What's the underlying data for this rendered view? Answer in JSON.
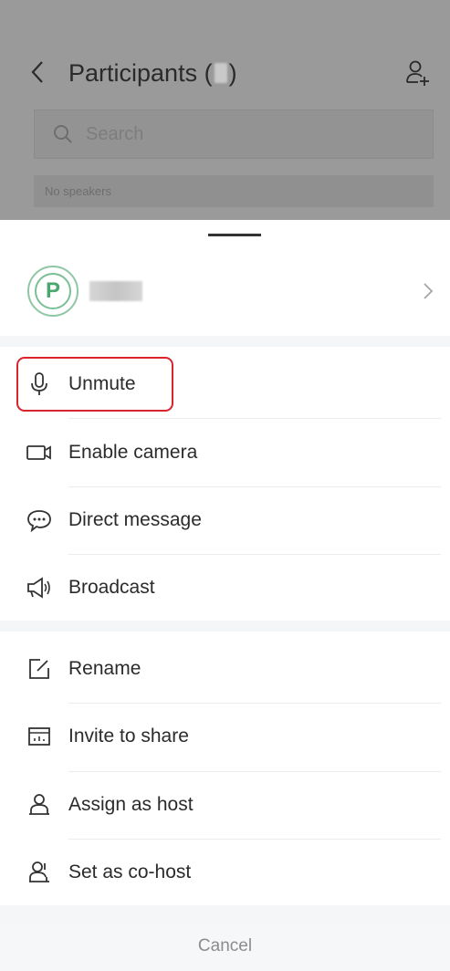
{
  "header": {
    "title": "Participants (",
    "title_suffix": ")",
    "search_placeholder": "Search",
    "speakers_text": "No speakers"
  },
  "menu": {
    "unmute": "Unmute",
    "enable_camera": "Enable camera",
    "direct_message": "Direct message",
    "broadcast": "Broadcast",
    "rename": "Rename",
    "invite_to_share": "Invite to share",
    "assign_as_host": "Assign as host",
    "set_as_cohost": "Set as co-host"
  },
  "footer": {
    "cancel": "Cancel"
  },
  "avatar_letter": "P",
  "colors": {
    "accent_green": "#4aa76e",
    "highlight_red": "#d9232d",
    "overlay_gray": "#9a9a9a"
  }
}
